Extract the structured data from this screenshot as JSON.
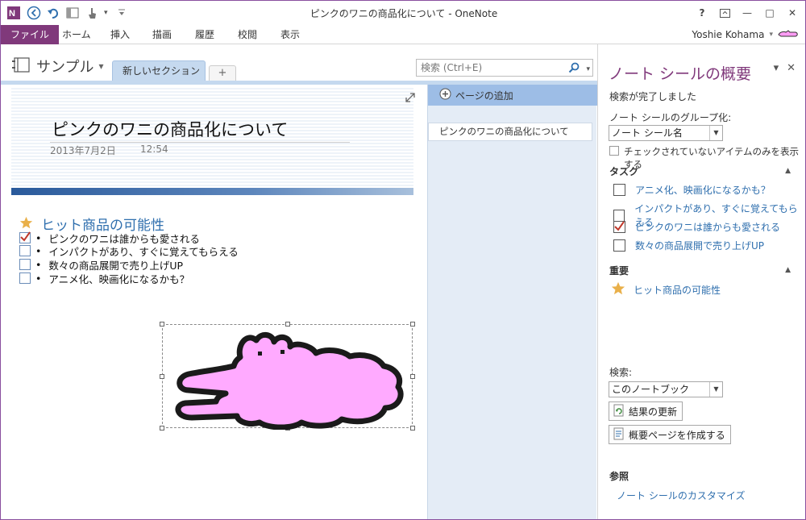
{
  "window": {
    "title": "ピンクのワニの商品化について - OneNote",
    "help": "?",
    "minimize": "—",
    "maximize": "□",
    "close": "✕",
    "qat_more": "▾"
  },
  "ribbon": {
    "tabs": [
      "ファイル",
      "ホーム",
      "挿入",
      "描画",
      "履歴",
      "校閲",
      "表示"
    ],
    "user": "Yoshie Kohama",
    "user_dropdown": "▾"
  },
  "notebook": {
    "name": "サンプル",
    "dropdown": "▾",
    "section_tab": "新しいセクション 1",
    "add_tab": "+",
    "search_placeholder": "検索 (Ctrl+E)",
    "search_dropdown": "▾"
  },
  "page": {
    "title": "ピンクのワニの商品化について",
    "date": "2013年7月2日",
    "time": "12:54",
    "heading": "ヒット商品の可能性",
    "tasks": [
      {
        "label": "ピンクのワニは誰からも愛される",
        "checked": true
      },
      {
        "label": "インパクトがあり、すぐに覚えてもらえる",
        "checked": false
      },
      {
        "label": "数々の商品展開で売り上げUP",
        "checked": false
      },
      {
        "label": "アニメ化、映画化になるかも？",
        "checked": false
      }
    ],
    "bullet": "•"
  },
  "pagelist": {
    "add_page": "ページの追加",
    "items": [
      "ピンクのワニの商品化について"
    ]
  },
  "pane": {
    "title": "ノート シールの概要",
    "pin": "▾",
    "close": "✕",
    "status": "検索が完了しました",
    "group_label": "ノート シールのグループ化:",
    "group_value": "ノート シール名",
    "combo_arrow": "▼",
    "unchecked_only": "チェックされていないアイテムのみを表示する",
    "task_section": "タスク",
    "collapse": "▲",
    "tasks": [
      {
        "label": "アニメ化、映画化になるかも？",
        "checked": false
      },
      {
        "label": "インパクトがあり、すぐに覚えてもらえる",
        "checked": false
      },
      {
        "label": "ピンクのワニは誰からも愛される",
        "checked": true
      },
      {
        "label": "数々の商品展開で売り上げUP",
        "checked": false
      }
    ],
    "important_section": "重要",
    "important_items": [
      "ヒット商品の可能性"
    ],
    "search_label": "検索:",
    "search_value": "このノートブック",
    "refresh_button": "結果の更新",
    "create_button": "概要ページを作成する",
    "ref_section": "参照",
    "customize_link": "ノート シールのカスタマイズ"
  },
  "colors": {
    "accent": "#80397b",
    "link_blue": "#2f6fae",
    "pink": "#ffaaff",
    "check_red": "#c0392b",
    "star": "#e9b04a"
  }
}
